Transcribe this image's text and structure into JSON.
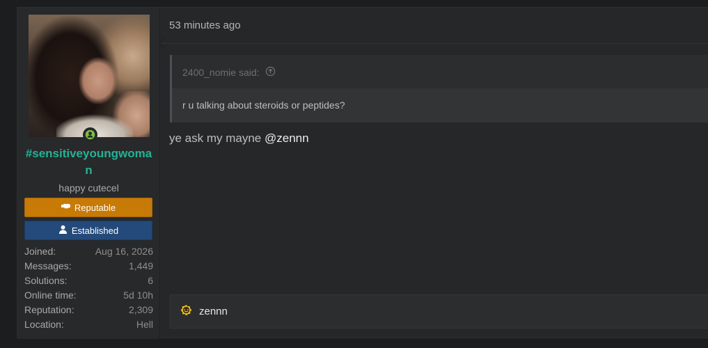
{
  "post": {
    "author": {
      "username": "#sensitiveyoungwoman",
      "user_title": "happy cutecel",
      "online_icon": "user-online-icon",
      "banners": [
        {
          "label": "Reputable",
          "icon": "handshake-icon",
          "color": "#c77a06"
        },
        {
          "label": "Established",
          "icon": "user-icon",
          "color": "#234a7a"
        }
      ],
      "stats": [
        {
          "label": "Joined:",
          "value": "Aug 16, 2026"
        },
        {
          "label": "Messages:",
          "value": "1,449"
        },
        {
          "label": "Solutions:",
          "value": "6"
        },
        {
          "label": "Online time:",
          "value": "5d 10h"
        },
        {
          "label": "Reputation:",
          "value": "2,309"
        },
        {
          "label": "Location:",
          "value": "Hell"
        }
      ]
    },
    "time": "53 minutes ago",
    "quote": {
      "author_line": "2400_nomie said:",
      "icon": "arrow-up-circle-icon",
      "text": "r u talking about steroids or peptides?"
    },
    "message": {
      "text": "ye ask my mayne ",
      "mention": "@zennn"
    },
    "reactions": {
      "icon": "reaction-badge-icon",
      "users": "zennn"
    }
  }
}
